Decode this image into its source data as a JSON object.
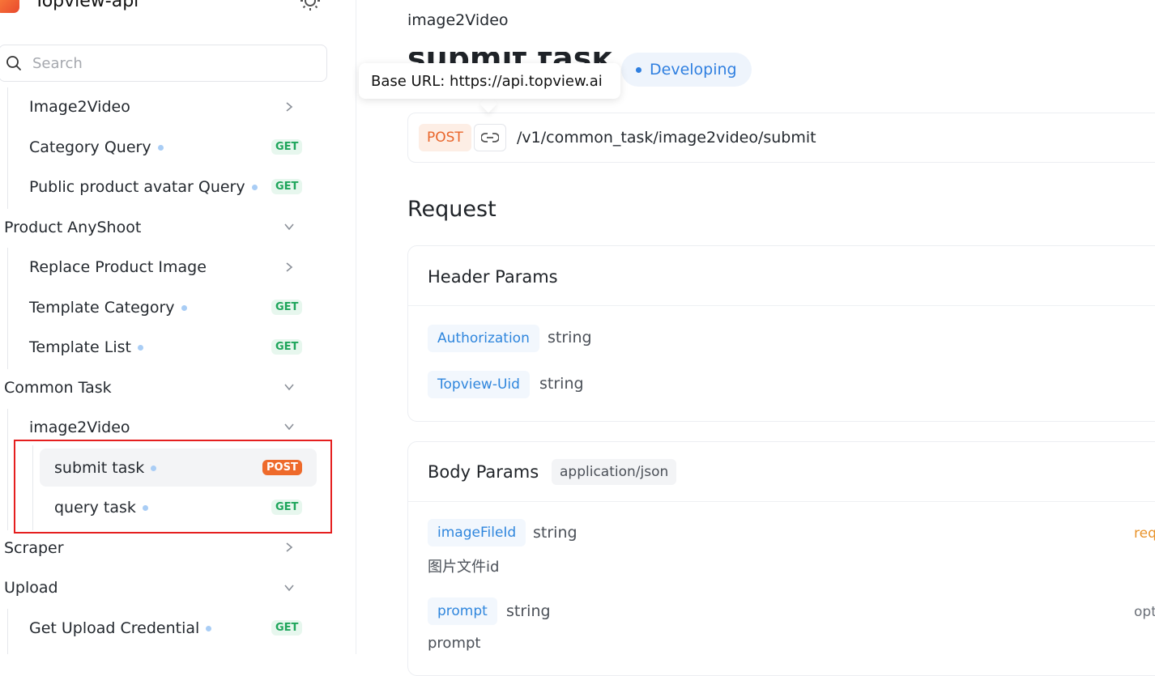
{
  "sidebar": {
    "app_title": "Topview-api",
    "search_placeholder": "Search",
    "items": [
      {
        "label": "Image2Video"
      },
      {
        "label": "Category Query",
        "method": "GET"
      },
      {
        "label": "Public product avatar Query",
        "method": "GET"
      },
      {
        "label": "Product AnyShoot"
      },
      {
        "label": "Replace Product Image"
      },
      {
        "label": "Template Category",
        "method": "GET"
      },
      {
        "label": "Template List",
        "method": "GET"
      },
      {
        "label": "Common Task"
      },
      {
        "label": "image2Video"
      },
      {
        "label": "submit task",
        "method": "POST"
      },
      {
        "label": "query task",
        "method": "GET"
      },
      {
        "label": "Scraper"
      },
      {
        "label": "Upload"
      },
      {
        "label": "Get Upload Credential",
        "method": "GET"
      }
    ]
  },
  "main": {
    "breadcrumb": "image2Video",
    "title": "submit task",
    "status": "Developing",
    "tooltip": "Base URL: https://api.topview.ai",
    "endpoint": {
      "method": "POST",
      "path": "/v1/common_task/image2video/submit"
    },
    "request_title": "Request",
    "header_params": {
      "title": "Header Params",
      "params": [
        {
          "name": "Authorization",
          "type": "string"
        },
        {
          "name": "Topview-Uid",
          "type": "string"
        }
      ]
    },
    "body_params": {
      "title": "Body Params",
      "content_type": "application/json",
      "params": [
        {
          "name": "imageFileId",
          "type": "string",
          "flag": "req",
          "description": "图片文件id"
        },
        {
          "name": "prompt",
          "type": "string",
          "flag": "opt",
          "description": "prompt"
        }
      ]
    }
  },
  "colors": {
    "accent": "#2f86dd",
    "post": "#ee6a2b",
    "get": "#1ea55b",
    "highlight": "#e51f1f"
  }
}
